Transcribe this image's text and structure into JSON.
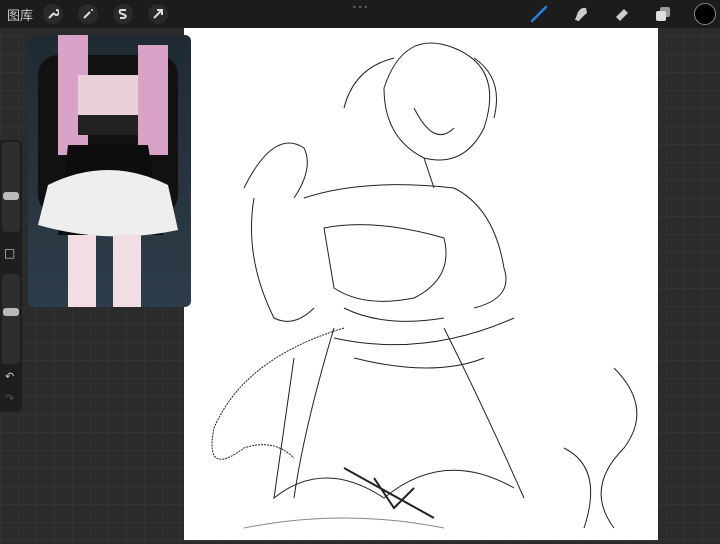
{
  "topbar": {
    "gallery_label": "图库",
    "left_tools": [
      "wrench-icon",
      "magic-wand-icon",
      "selection-icon",
      "transform-arrow-icon"
    ],
    "right_tools": [
      "brush-icon",
      "smudge-icon",
      "eraser-icon",
      "layers-icon"
    ],
    "current_color": "#000000",
    "active_tool_color": "#2a7de1"
  },
  "sidebar": {
    "size_slider": 0.3,
    "opacity_slider": 0.4,
    "undo": "↶",
    "redo": "↷",
    "modify": "□"
  }
}
